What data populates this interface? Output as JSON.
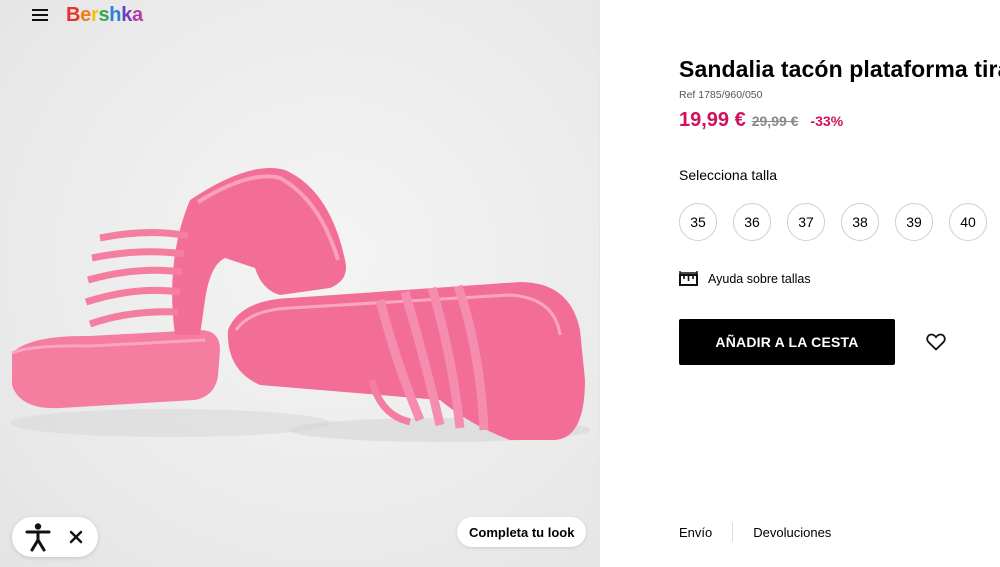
{
  "brand": {
    "name_letters": [
      "B",
      "e",
      "r",
      "s",
      "h",
      "k",
      "a"
    ],
    "name_colors": [
      "#e8312f",
      "#f07d1a",
      "#f2c412",
      "#35a852",
      "#2f7fd6",
      "#6a3fbf",
      "#b23ea3"
    ]
  },
  "media": {
    "complete_look_label": "Completa tu look"
  },
  "product": {
    "title": "Sandalia tacón plataforma tiras",
    "ref": "Ref 1785/960/050",
    "price": "19,99 €",
    "old_price": "29,99 €",
    "discount": "-33%"
  },
  "sizes": {
    "label": "Selecciona talla",
    "options": [
      "35",
      "36",
      "37",
      "38",
      "39",
      "40"
    ]
  },
  "size_help": {
    "label": "Ayuda sobre tallas"
  },
  "cart": {
    "add_label": "AÑADIR A LA CESTA"
  },
  "footer": {
    "shipping_label": "Envío",
    "returns_label": "Devoluciones"
  },
  "colors": {
    "price_accent": "#d1125b",
    "button_bg": "#000000",
    "shoe_pink": "#f47da0"
  },
  "icons": [
    "menu-icon",
    "accessibility-icon",
    "close-icon",
    "ruler-icon",
    "heart-icon"
  ]
}
